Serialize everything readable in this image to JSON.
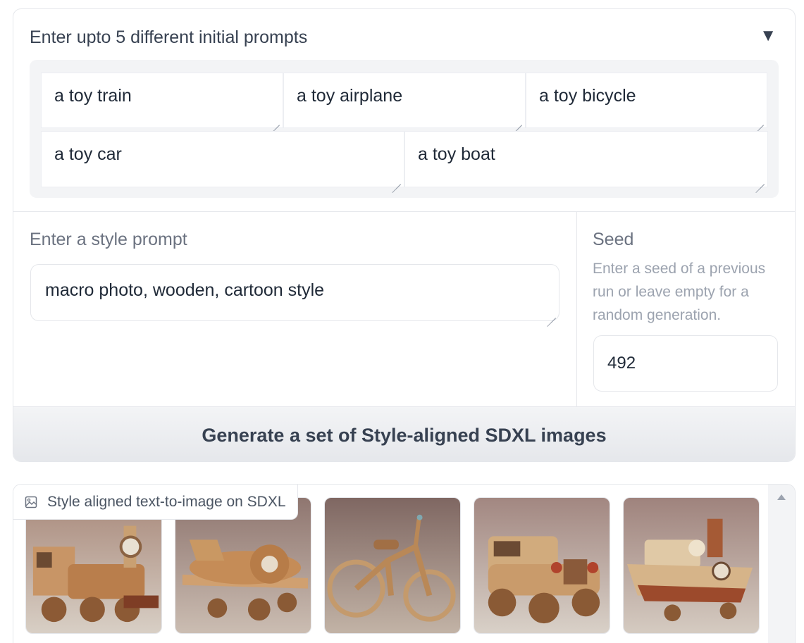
{
  "prompts_section": {
    "title": "Enter upto 5 different initial prompts",
    "toggle_icon": "▼",
    "prompts": [
      "a toy train",
      "a toy airplane",
      "a toy bicycle",
      "a toy car",
      "a toy boat"
    ]
  },
  "style": {
    "label": "Enter a style prompt",
    "value": "macro photo, wooden, cartoon style"
  },
  "seed": {
    "label": "Seed",
    "info": "Enter a seed of a previous run or leave empty for a random generation.",
    "value": "492"
  },
  "generate_button": "Generate a set of Style-aligned SDXL images",
  "gallery": {
    "label": "Style aligned text-to-image on SDXL",
    "label_icon": "image-icon",
    "items": [
      "toy-train-image",
      "toy-airplane-image",
      "toy-bicycle-image",
      "toy-car-image",
      "toy-boat-image"
    ]
  }
}
